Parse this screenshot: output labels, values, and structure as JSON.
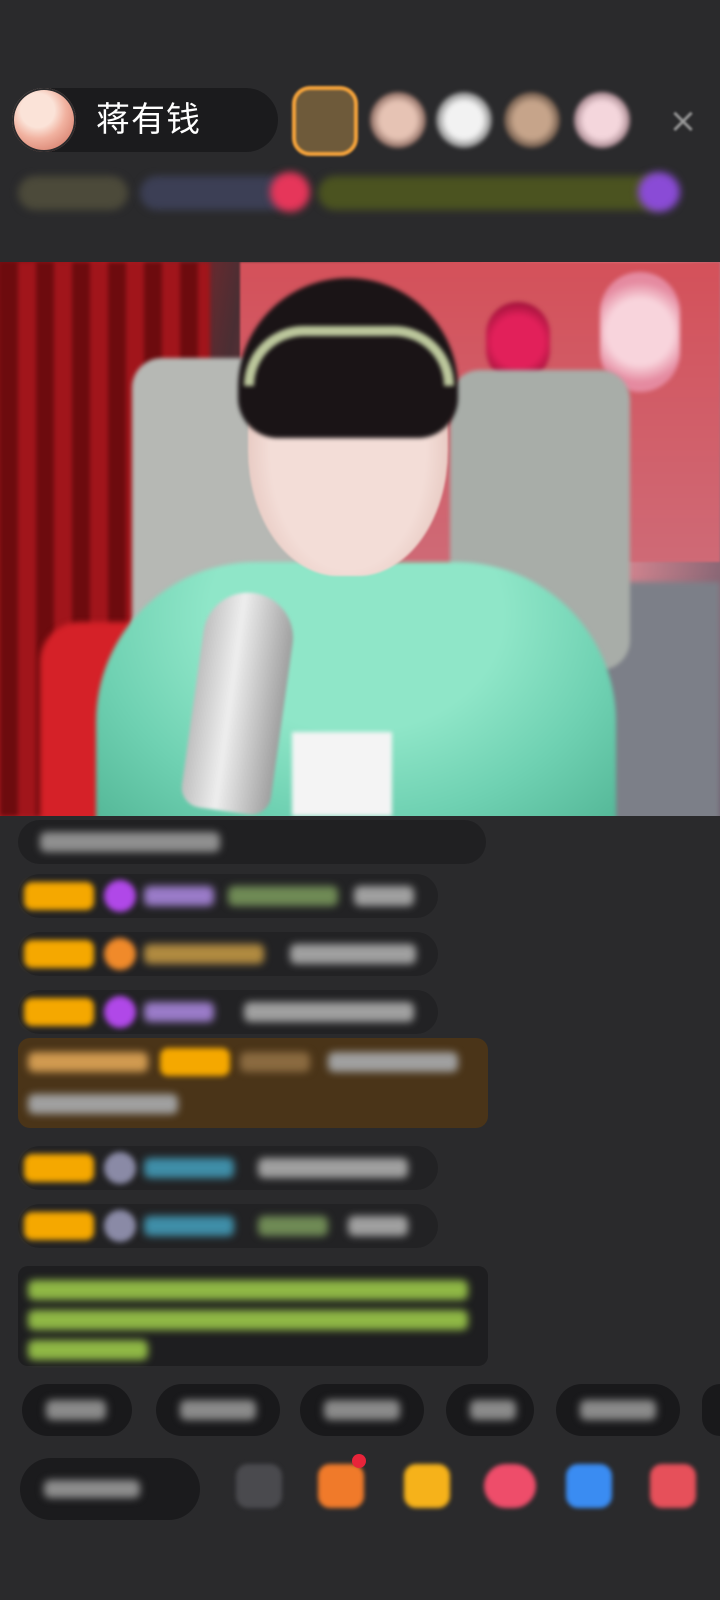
{
  "header": {
    "host_name": "蒋有钱",
    "close_icon": "×",
    "viewer_avatars": 5
  },
  "stream": {
    "description_icon": "live-video"
  },
  "chat": {
    "message_count": 8
  },
  "quick_replies": {
    "count": 6
  },
  "bottom_bar": {
    "icons": [
      "more-icon",
      "gift-box-icon",
      "gift-icon",
      "pk-icon",
      "chat-bubble-icon",
      "menu-icon"
    ]
  },
  "colors": {
    "background": "#2a2a2c",
    "badge": "#f5a800",
    "gift_message": "#4a3418",
    "notice_text": "#9ed050"
  }
}
